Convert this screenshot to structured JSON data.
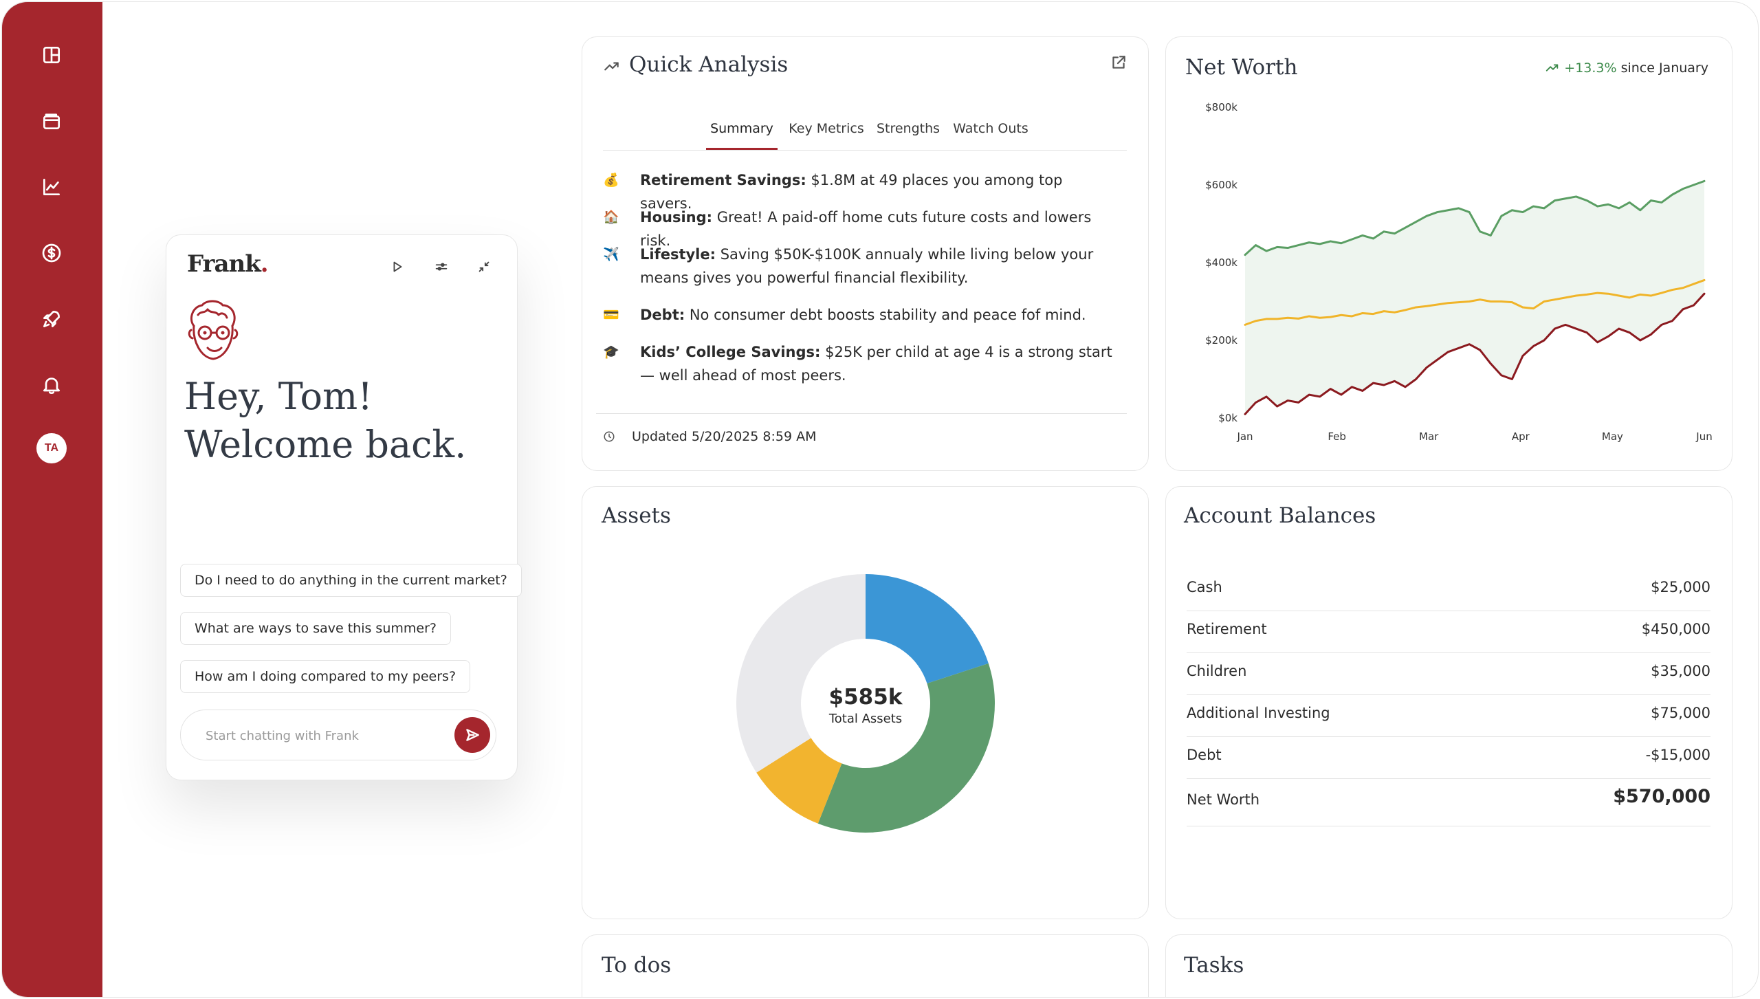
{
  "sidebar": {
    "icons": [
      "layout-icon",
      "wallet-icon",
      "chart-icon",
      "dollar-icon",
      "rocket-icon",
      "bell-icon"
    ],
    "avatar_initials": "TA"
  },
  "chat": {
    "logo": "Frank",
    "logo_dot": ".",
    "greeting_line1": "Hey, Tom!",
    "greeting_line2": "Welcome back.",
    "suggestions": [
      "Do I need to do anything in the current market?",
      "What are ways to save this summer?",
      "How am I doing compared to my peers?"
    ],
    "input_placeholder": "Start chatting with Frank"
  },
  "quick_analysis": {
    "title": "Quick Analysis",
    "tabs": [
      "Summary",
      "Key Metrics",
      "Strengths",
      "Watch Outs"
    ],
    "active_tab": "Summary",
    "items": [
      {
        "emoji": "💰",
        "label": "Retirement Savings:",
        "text": " $1.8M at 49 places you among top savers."
      },
      {
        "emoji": "🏠",
        "label": "Housing:",
        "text": " Great! A paid-off home cuts future costs and lowers risk."
      },
      {
        "emoji": "✈️",
        "label": "Lifestyle:",
        "text": " Saving $50K-$100K annualy while living below your means gives you powerful financial flexibility."
      },
      {
        "emoji": "💳",
        "label": "Debt:",
        "text": " No consumer debt boosts stability and peace fof mind."
      },
      {
        "emoji": "🎓",
        "label": "Kids’ College Savings:",
        "text": " $25K per child at age 4 is a strong start — well ahead of most peers."
      }
    ],
    "updated": "Updated 5/20/2025 8:59 AM"
  },
  "net_worth": {
    "title": "Net Worth",
    "delta_pct": "+13.3%",
    "delta_suffix": "since January",
    "colors": {
      "green": "#5a9e63",
      "yellow": "#f0b429",
      "red": "#8b1a1f",
      "fill": "#eef5ef"
    }
  },
  "chart_data": {
    "type": "line",
    "title": "Net Worth",
    "x_ticks": [
      "Jan",
      "Feb",
      "Mar",
      "Apr",
      "May",
      "Jun"
    ],
    "y_ticks": [
      "$0k",
      "$200k",
      "$400k",
      "$600k",
      "$800k"
    ],
    "ylim": [
      0,
      800
    ],
    "grid": false,
    "series": [
      {
        "color": "#5a9e63",
        "values": [
          420,
          445,
          430,
          440,
          438,
          445,
          452,
          448,
          455,
          450,
          460,
          470,
          462,
          480,
          475,
          490,
          505,
          520,
          530,
          535,
          540,
          530,
          480,
          470,
          520,
          535,
          530,
          545,
          540,
          560,
          565,
          570,
          560,
          545,
          550,
          540,
          555,
          535,
          560,
          555,
          575,
          590,
          600,
          610
        ]
      },
      {
        "color": "#f0b429",
        "values": [
          240,
          250,
          255,
          255,
          258,
          256,
          262,
          258,
          260,
          265,
          262,
          270,
          268,
          275,
          272,
          278,
          285,
          288,
          292,
          296,
          298,
          300,
          305,
          300,
          300,
          298,
          285,
          282,
          300,
          305,
          310,
          315,
          318,
          322,
          320,
          315,
          310,
          318,
          315,
          322,
          330,
          335,
          345,
          355
        ]
      },
      {
        "color": "#8b1a1f",
        "values": [
          10,
          40,
          55,
          30,
          45,
          40,
          60,
          55,
          75,
          60,
          80,
          70,
          90,
          85,
          95,
          80,
          100,
          130,
          150,
          170,
          180,
          190,
          175,
          140,
          110,
          100,
          160,
          185,
          200,
          230,
          240,
          230,
          220,
          195,
          210,
          230,
          220,
          200,
          215,
          240,
          250,
          280,
          290,
          320
        ]
      }
    ]
  },
  "assets": {
    "title": "Assets",
    "center_value": "$585k",
    "center_label": "Total Assets",
    "slices": [
      {
        "value": 20,
        "color": "#3b96d6"
      },
      {
        "value": 36,
        "color": "#5e9c6d"
      },
      {
        "value": 10,
        "color": "#f2b42f"
      },
      {
        "value": 34,
        "color": "#e9e9ec"
      }
    ]
  },
  "account_balances": {
    "title": "Account Balances",
    "rows": [
      {
        "label": "Cash",
        "value": "$25,000"
      },
      {
        "label": "Retirement",
        "value": "$450,000"
      },
      {
        "label": "Children",
        "value": "$35,000"
      },
      {
        "label": "Additional Investing",
        "value": "$75,000"
      },
      {
        "label": "Debt",
        "value": "-$15,000"
      },
      {
        "label": "Net Worth",
        "value": "$570,000"
      }
    ]
  },
  "todos": {
    "title": "To dos"
  },
  "tasks": {
    "title": "Tasks"
  }
}
